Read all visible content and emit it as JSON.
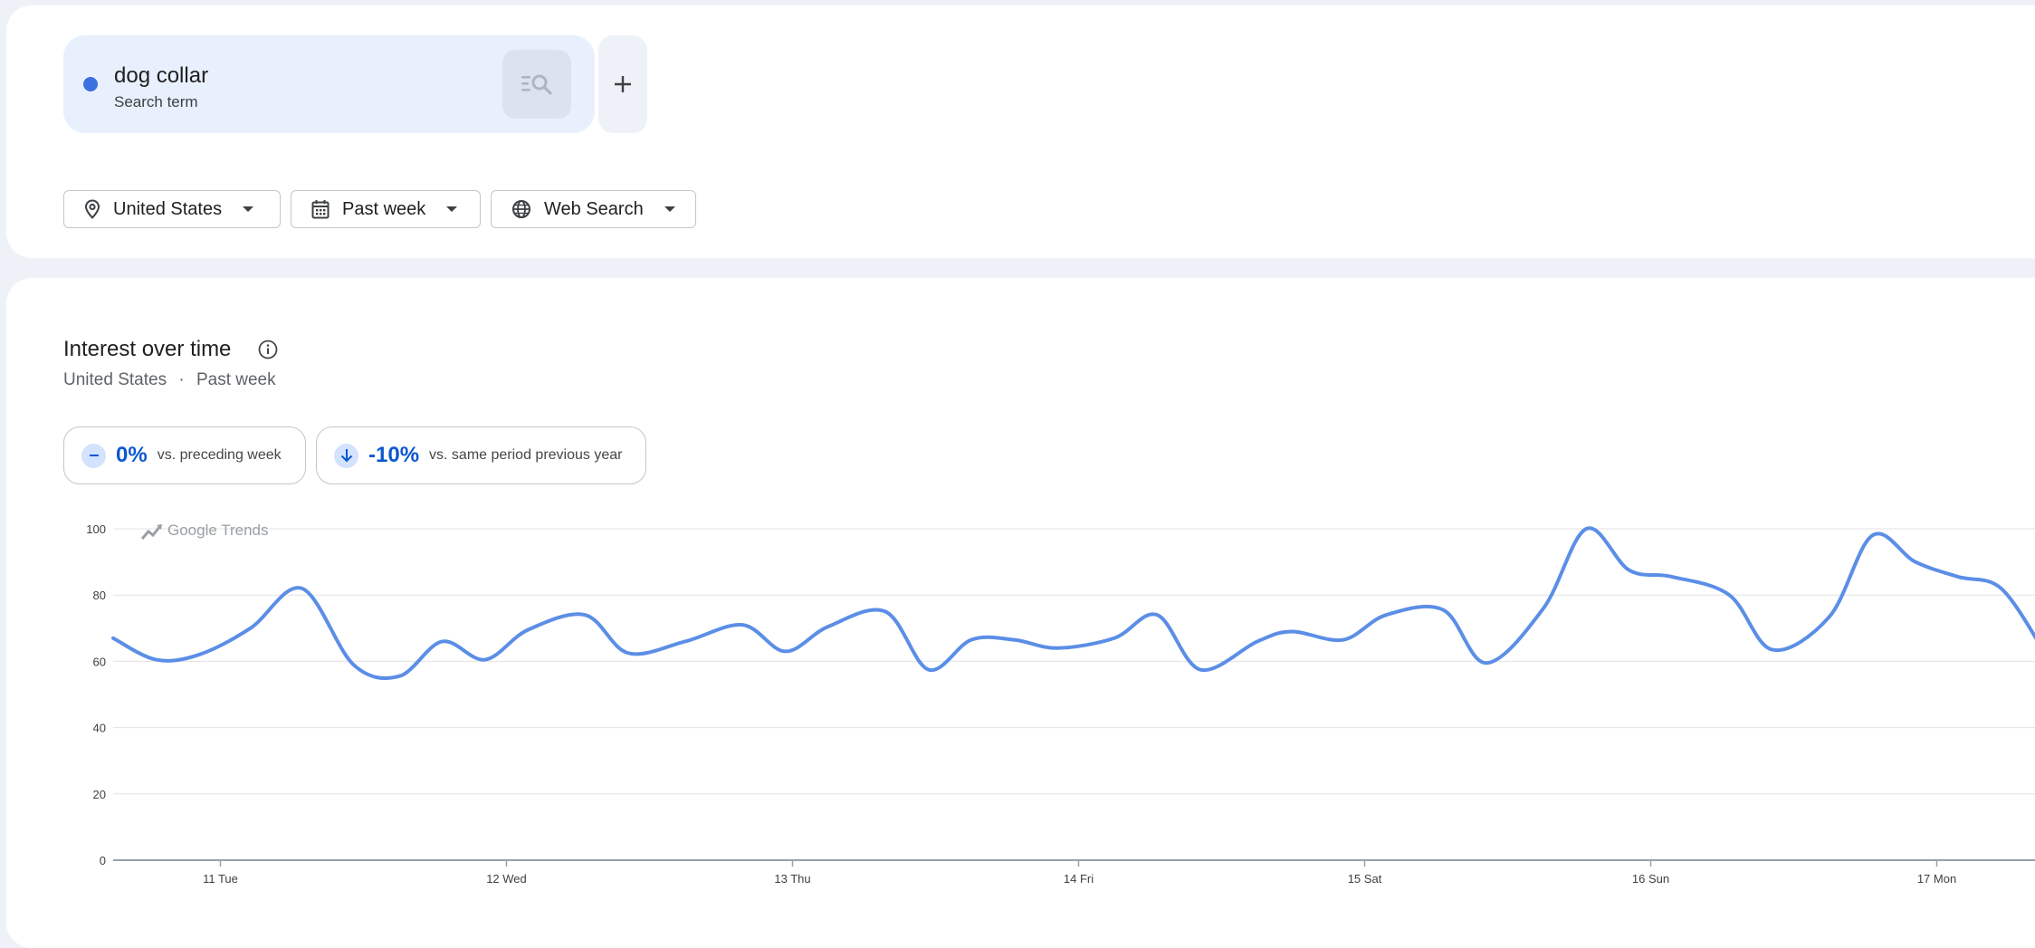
{
  "search_terms": [
    {
      "name": "dog collar",
      "type": "Search term",
      "color": "#3b72e0"
    }
  ],
  "icons": {
    "term_search": "search-list-icon",
    "add": "plus-icon",
    "location": "location-pin-icon",
    "calendar": "calendar-icon",
    "globe": "globe-icon",
    "caret": "caret-down-icon",
    "info": "info-icon",
    "neutral": "minus-icon",
    "down": "arrow-down-icon",
    "trends": "trends-line-icon"
  },
  "filters": {
    "region": "United States",
    "period": "Past week",
    "property": "Web Search"
  },
  "interest_section": {
    "title": "Interest over time",
    "subtitle_region": "United States",
    "subtitle_sep": "·",
    "subtitle_period": "Past week",
    "stats": [
      {
        "value": "0%",
        "label": "vs. preceding week"
      },
      {
        "value": "-10%",
        "label": "vs. same period previous year"
      }
    ],
    "watermark": "Google Trends"
  },
  "chart_data": {
    "type": "line",
    "series": [
      {
        "color": "#5b8ee6",
        "points": [
          [
            0.0,
            67
          ],
          [
            0.15,
            60.5
          ],
          [
            0.3,
            62
          ],
          [
            0.48,
            70
          ],
          [
            0.66,
            82
          ],
          [
            0.84,
            59
          ],
          [
            1.0,
            55.5
          ],
          [
            1.15,
            66
          ],
          [
            1.3,
            60.5
          ],
          [
            1.45,
            69.5
          ],
          [
            1.65,
            74
          ],
          [
            1.8,
            62.5
          ],
          [
            2.0,
            66
          ],
          [
            2.2,
            71
          ],
          [
            2.35,
            63
          ],
          [
            2.5,
            70.5
          ],
          [
            2.7,
            75
          ],
          [
            2.85,
            57.5
          ],
          [
            3.0,
            66.5
          ],
          [
            3.15,
            66.5
          ],
          [
            3.3,
            64
          ],
          [
            3.5,
            67
          ],
          [
            3.65,
            74
          ],
          [
            3.8,
            57.5
          ],
          [
            4.0,
            66
          ],
          [
            4.12,
            69
          ],
          [
            4.3,
            66.5
          ],
          [
            4.45,
            74
          ],
          [
            4.65,
            75.5
          ],
          [
            4.8,
            59.5
          ],
          [
            5.0,
            76
          ],
          [
            5.15,
            100
          ],
          [
            5.3,
            87.5
          ],
          [
            5.45,
            85.5
          ],
          [
            5.65,
            80
          ],
          [
            5.8,
            63.5
          ],
          [
            6.0,
            73.5
          ],
          [
            6.15,
            98
          ],
          [
            6.3,
            90
          ],
          [
            6.45,
            85.5
          ],
          [
            6.6,
            82
          ],
          [
            6.75,
            63
          ]
        ]
      }
    ],
    "x_ticks": [
      {
        "x": 0.375,
        "label": "11 Tue"
      },
      {
        "x": 1.375,
        "label": "12 Wed"
      },
      {
        "x": 2.375,
        "label": "13 Thu"
      },
      {
        "x": 3.375,
        "label": "14 Fri"
      },
      {
        "x": 4.375,
        "label": "15 Sat"
      },
      {
        "x": 5.375,
        "label": "16 Sun"
      },
      {
        "x": 6.375,
        "label": "17 Mon"
      }
    ],
    "y_ticks": [
      0,
      20,
      40,
      60,
      80,
      100
    ],
    "ylim": [
      0,
      100
    ],
    "xlim": [
      0,
      6.5
    ],
    "grid": true,
    "legend": "none"
  }
}
